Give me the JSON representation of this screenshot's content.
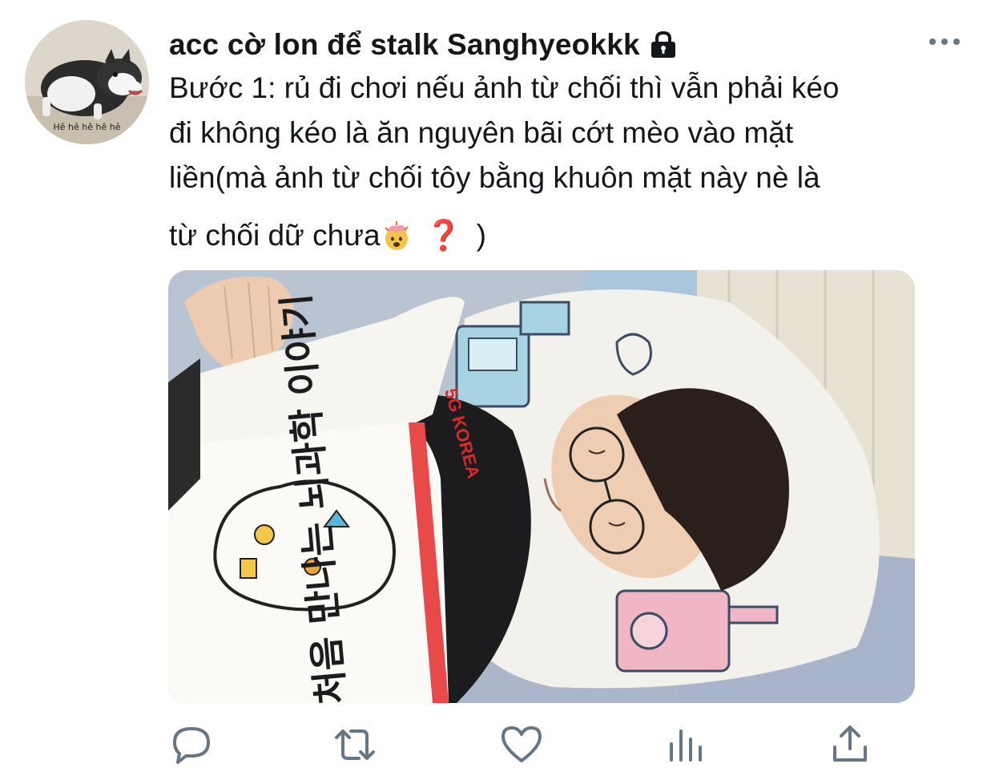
{
  "tweet": {
    "display_name": "acc cờ lon để stalk Sanghyeokkk",
    "protected_icon": "lock-icon",
    "more_icon": "more-dots-icon",
    "avatar": {
      "caption": "Hê hê hê hê hê"
    },
    "text_lines": [
      "Bước 1: rủ đi chơi nếu ảnh từ chối thì vẫn phải kéo",
      "đi không kéo là ăn nguyên bãi cớt mèo vào mặt",
      "liền(mà ảnh từ chối tôy bằng khuôn mặt này nè là"
    ],
    "last_line": {
      "text_before": "từ chối dữ chưa",
      "emoji_1": "🤯",
      "emoji_2": "❓",
      "text_after": ")"
    },
    "media": {
      "book_title": "처음 만나는 뇌과학 이야기",
      "shirt_text": "5G KOREA"
    }
  },
  "actions": [
    {
      "name": "reply",
      "icon": "reply-icon"
    },
    {
      "name": "retweet",
      "icon": "retweet-icon"
    },
    {
      "name": "like",
      "icon": "heart-icon"
    },
    {
      "name": "analytics",
      "icon": "analytics-icon"
    },
    {
      "name": "share",
      "icon": "share-icon"
    }
  ],
  "colors": {
    "text": "#14171a",
    "icon_gray": "#657786",
    "question_red": "#d32222"
  }
}
